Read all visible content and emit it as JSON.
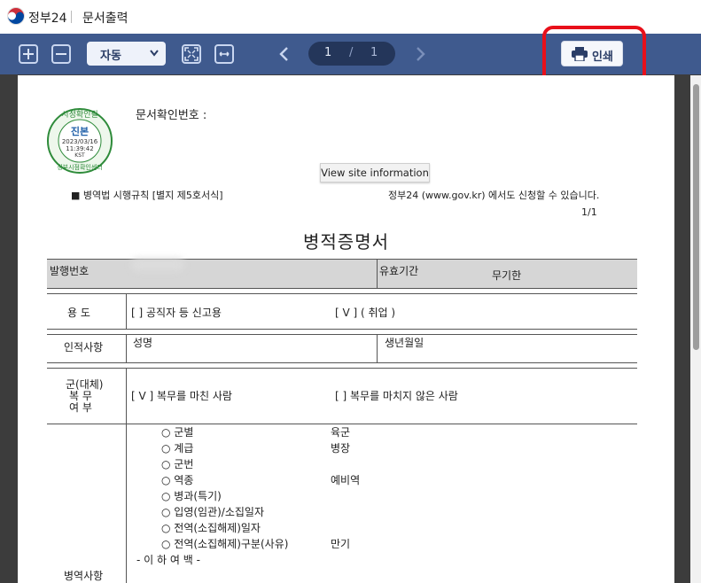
{
  "app": {
    "name": "정부24",
    "window_title": "문서출력"
  },
  "toolbar": {
    "zoom_value": "자동",
    "page_current": "1",
    "page_separator": "/",
    "page_total": "1",
    "print_label": "인쇄"
  },
  "stamp": {
    "top_text": "시정확인필",
    "main": "진본",
    "date": "2023/03/16",
    "time": "11:39:42",
    "tz": "KST",
    "bottom_text": "정부시점확인센터"
  },
  "document": {
    "confirm_label": "문서확인번호 :",
    "tooltip": "View site information",
    "form_ref": "■ 병역법 시행규칙 [별지 제5호서식]",
    "apply_text": "정부24 (www.gov.kr) 에서도 신청할 수 있습니다.",
    "page_num": "1/1",
    "title": "병적증명서",
    "issue_no_label": "발행번호",
    "validity_label": "유효기간",
    "validity_value": "무기한",
    "purpose_label": "용   도",
    "purpose_opt1": "[      ] 공직자 등 신고용",
    "purpose_opt2": "[  V  ] ( 취업 )",
    "person_label": "인적사항",
    "name_label": "성명",
    "dob_label": "생년월일",
    "service_label_1": "군(대체)",
    "service_label_2": "복    무",
    "service_label_3": "여    부",
    "served_opt": "[  V  ] 복무를 마친 사람",
    "not_served_opt": "[      ] 복무를 마치지 않은 사람",
    "record_label": "병역사항",
    "records": [
      {
        "label": "○  군별",
        "value": "육군"
      },
      {
        "label": "○  계급",
        "value": "병장"
      },
      {
        "label": "○  군번",
        "value": ""
      },
      {
        "label": "○  역종",
        "value": "예비역"
      },
      {
        "label": "○  병과(특기)",
        "value": ""
      },
      {
        "label": "○  입영(임관)/소집일자",
        "value": ""
      },
      {
        "label": "○  전역(소집해제)일자",
        "value": ""
      },
      {
        "label": "○  전역(소집해제)구분(사유)",
        "value": "만기"
      }
    ],
    "end_text": "- 이 하 여 백 -"
  },
  "colors": {
    "toolbar": "#3f5a8e",
    "highlight": "#e8101a",
    "page_pill": "#24365a"
  }
}
